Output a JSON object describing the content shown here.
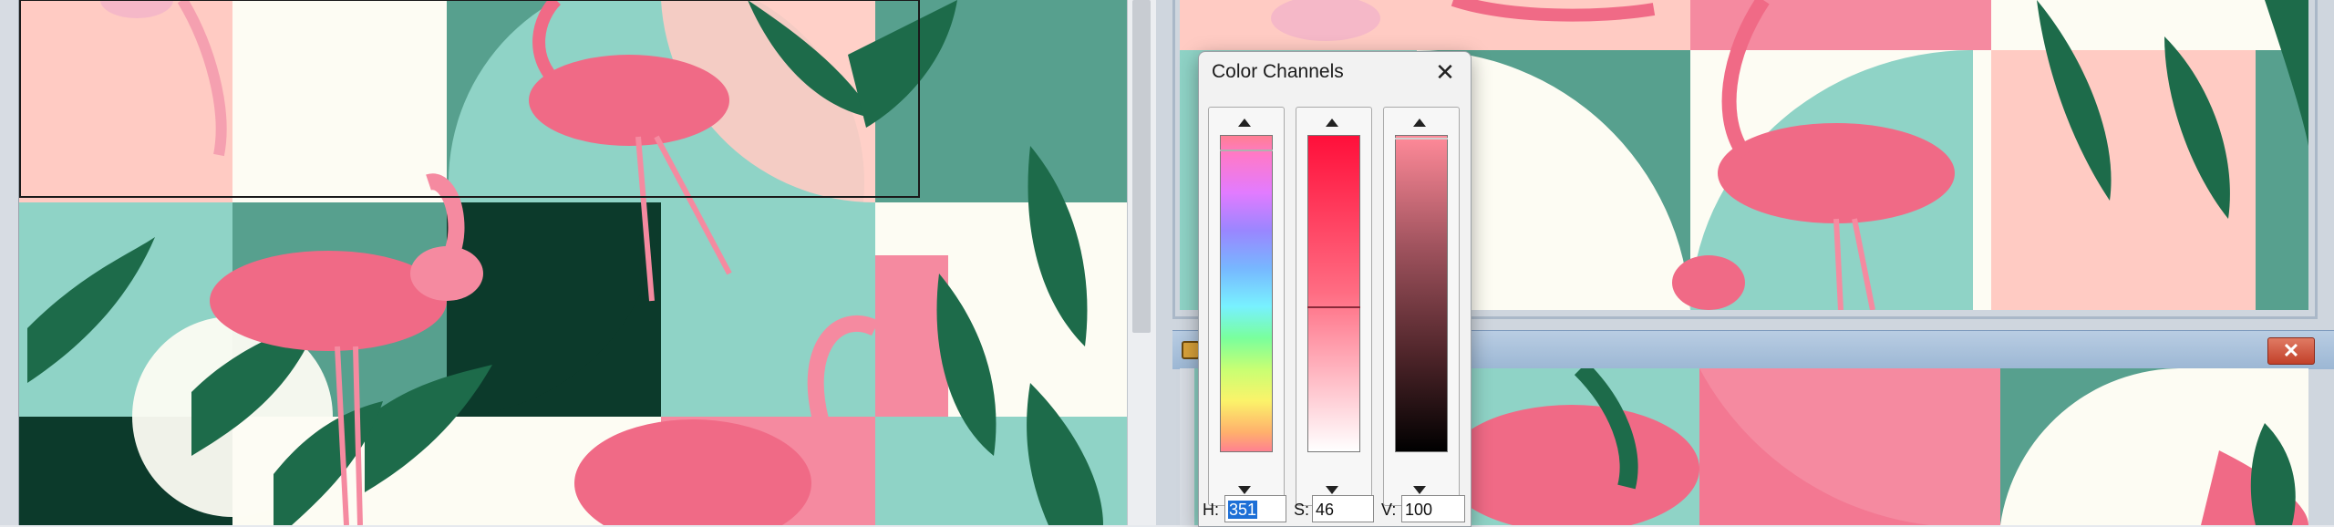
{
  "dialog": {
    "title": "Color Channels",
    "close_glyph": "✕",
    "channels": [
      {
        "name": "hue",
        "value": 351
      },
      {
        "name": "saturation",
        "value": 46
      },
      {
        "name": "value",
        "value": 100
      }
    ],
    "fields": {
      "h_label": "H:",
      "h_value": "351",
      "s_label": "S:",
      "s_value": "46",
      "v_label": "V:",
      "v_value": "100"
    }
  },
  "right_bottom_window": {
    "close_glyph": "✕"
  },
  "colors": {
    "pink": "#f58aa0",
    "light_pink": "#ffcbc3",
    "teal": "#8fd3c6",
    "dark_teal": "#57a08e",
    "forest": "#0c3a2b",
    "leaf": "#1d6b4a",
    "cream": "#fdfcf3",
    "flamingo": "#f06a86"
  }
}
